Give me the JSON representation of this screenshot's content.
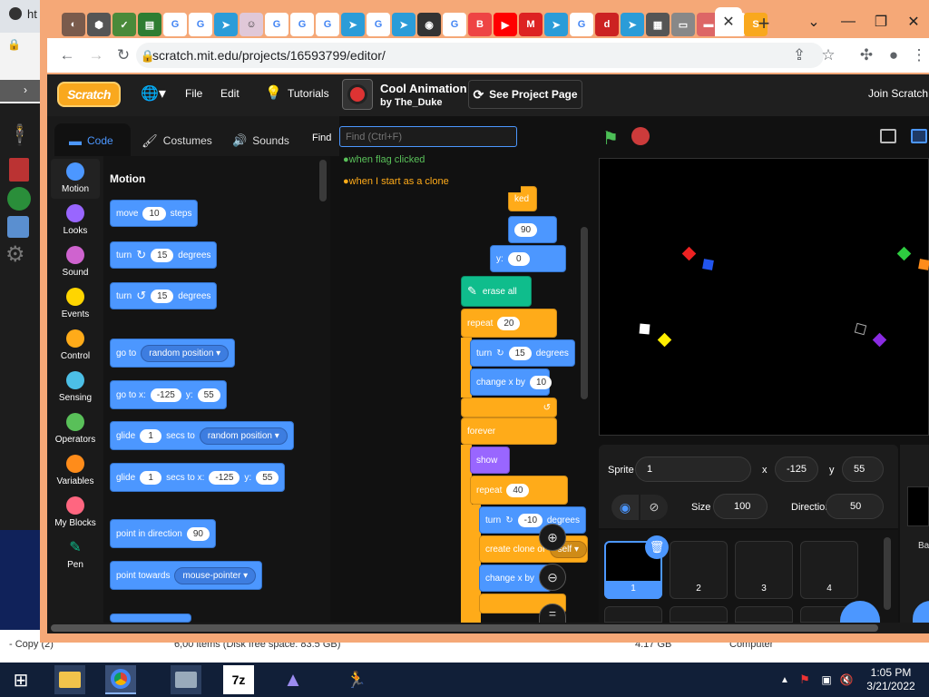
{
  "browser": {
    "bg_tab_fragment": "ht",
    "url": "scratch.mit.edu/projects/16593799/editor/"
  },
  "menubar": {
    "logo": "Scratch",
    "file": "File",
    "edit": "Edit",
    "tutorials": "Tutorials",
    "project_title": "Cool Animation",
    "project_author": "by The_Duke",
    "see_project_page": "See Project Page",
    "join": "Join Scratch"
  },
  "tabs": {
    "code": "Code",
    "costumes": "Costumes",
    "sounds": "Sounds"
  },
  "find": {
    "label": "Find",
    "placeholder": "Find (Ctrl+F)",
    "results": [
      "when flag clicked",
      "when I start as a clone"
    ]
  },
  "categories": [
    {
      "label": "Motion",
      "color": "#4c97ff"
    },
    {
      "label": "Looks",
      "color": "#9966ff"
    },
    {
      "label": "Sound",
      "color": "#cf63cf"
    },
    {
      "label": "Events",
      "color": "#ffd500"
    },
    {
      "label": "Control",
      "color": "#ffab19"
    },
    {
      "label": "Sensing",
      "color": "#4cbfe6"
    },
    {
      "label": "Operators",
      "color": "#59c059"
    },
    {
      "label": "Variables",
      "color": "#ff8c1a"
    },
    {
      "label": "My Blocks",
      "color": "#ff6680"
    },
    {
      "label": "Pen",
      "color": "#0fbd8c"
    }
  ],
  "palette": {
    "heading": "Motion",
    "move": {
      "a": "move",
      "v": "10",
      "b": "steps"
    },
    "turn_right": {
      "a": "turn",
      "v": "15",
      "b": "degrees"
    },
    "turn_left": {
      "a": "turn",
      "v": "15",
      "b": "degrees"
    },
    "goto": {
      "a": "go to",
      "dd": "random position"
    },
    "goto_xy": {
      "a": "go to x:",
      "x": "-125",
      "b": "y:",
      "y": "55"
    },
    "glide": {
      "a": "glide",
      "v": "1",
      "b": "secs to",
      "dd": "random position"
    },
    "glide_xy": {
      "a": "glide",
      "v": "1",
      "b": "secs to x:",
      "x": "-125",
      "c": "y:",
      "y": "55"
    },
    "point_dir": {
      "a": "point in direction",
      "v": "90"
    },
    "point_towards": {
      "a": "point towards",
      "dd": "mouse-pointer"
    }
  },
  "code": {
    "hat_fragment": "ked",
    "val_90": "90",
    "y_label": "y:",
    "y_val": "0",
    "erase": "erase all",
    "repeat1": {
      "a": "repeat",
      "v": "20"
    },
    "turn": {
      "a": "turn",
      "v": "15",
      "b": "degrees"
    },
    "changex": {
      "a": "change x by",
      "v": "10"
    },
    "forever": "forever",
    "show": "show",
    "repeat2": {
      "a": "repeat",
      "v": "40"
    },
    "turn2": {
      "a": "turn",
      "v": "-10",
      "b": "degrees"
    },
    "clone": {
      "a": "create clone of",
      "dd": "self"
    },
    "changex2": {
      "a": "change x by"
    }
  },
  "sprite_info": {
    "sprite_label": "Sprite",
    "sprite_name": "1",
    "x_label": "x",
    "x_val": "-125",
    "y_label": "y",
    "y_val": "55",
    "show_label": "Show",
    "size_label": "Size",
    "size_val": "100",
    "direction_label": "Direction",
    "direction_val": "50"
  },
  "sprites": [
    "1",
    "2",
    "3",
    "4"
  ],
  "stage_label": "Ba",
  "desktop": {
    "status_left": "- Copy (2)",
    "status_mid": "6,00 items (Disk free space: 83.5 GB)",
    "status_right": "Computer",
    "status_size": "4.17 GB"
  },
  "taskbar": {
    "time": "1:05 PM",
    "date": "3/21/2022",
    "zip": "7z"
  }
}
